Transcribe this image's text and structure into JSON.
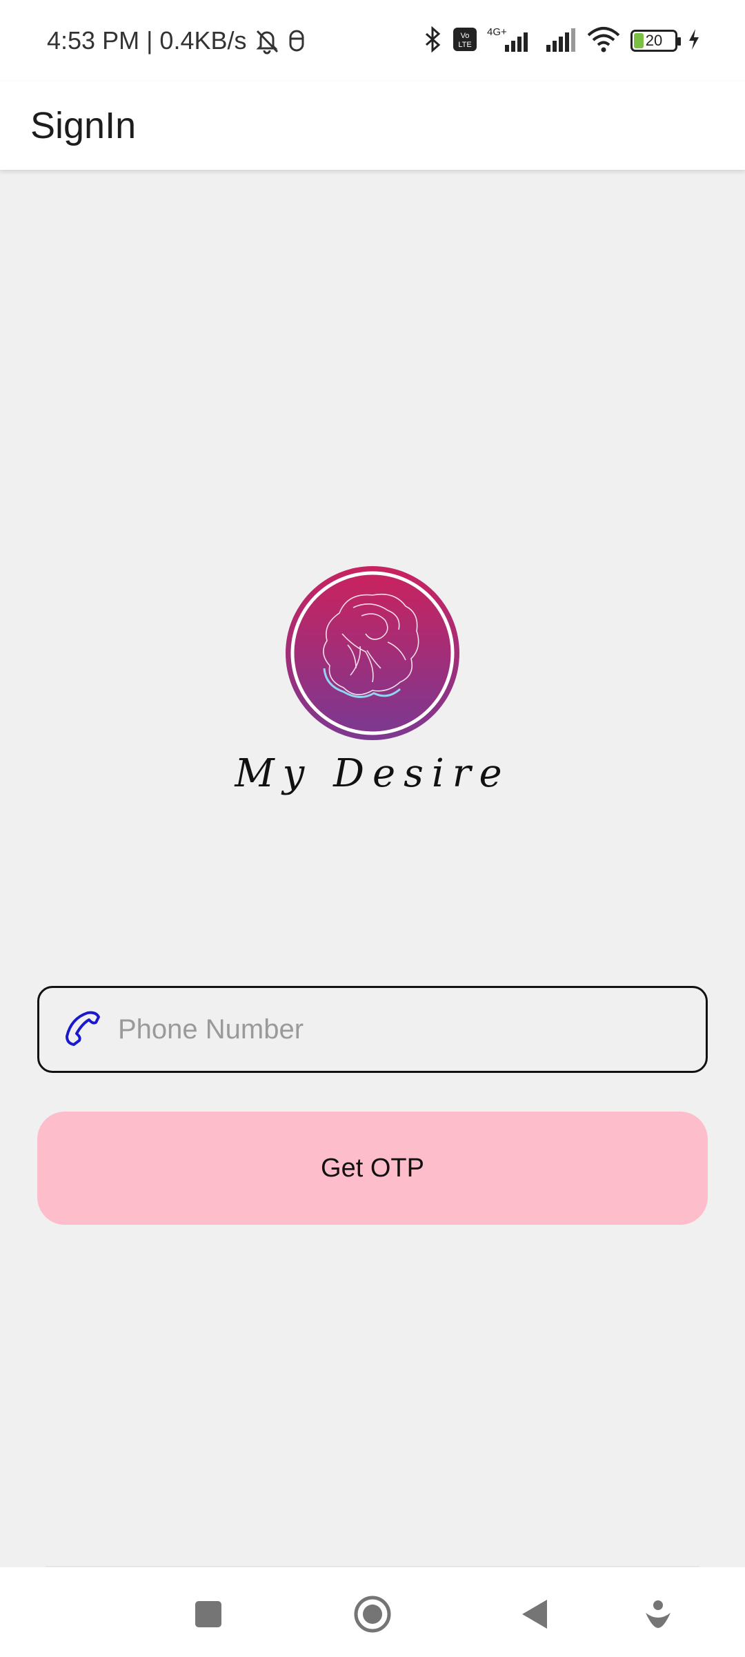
{
  "status_bar": {
    "time_speed": "4:53 PM | 0.4KB/s",
    "network_label": "4G+",
    "volte_label": "Vo LTE",
    "battery_level": "20",
    "icons": [
      "bell-off-icon",
      "mouse-icon",
      "bluetooth-icon",
      "volte-icon",
      "signal-icon",
      "signal-icon",
      "wifi-icon",
      "battery-icon",
      "charging-icon"
    ]
  },
  "app_bar": {
    "title": "SignIn"
  },
  "logo": {
    "brand_name": "My Desire",
    "colors": {
      "top": "#c8235f",
      "bottom": "#7d3890"
    }
  },
  "form": {
    "phone_placeholder": "Phone Number",
    "phone_value": "",
    "phone_icon": "phone-icon",
    "submit_label": "Get OTP",
    "accent": "#fdbdcb",
    "icon_color": "#1a1acc"
  },
  "nav_bar": {
    "icons": [
      "recents-square-icon",
      "home-circle-icon",
      "back-triangle-icon",
      "assistant-icon"
    ]
  }
}
